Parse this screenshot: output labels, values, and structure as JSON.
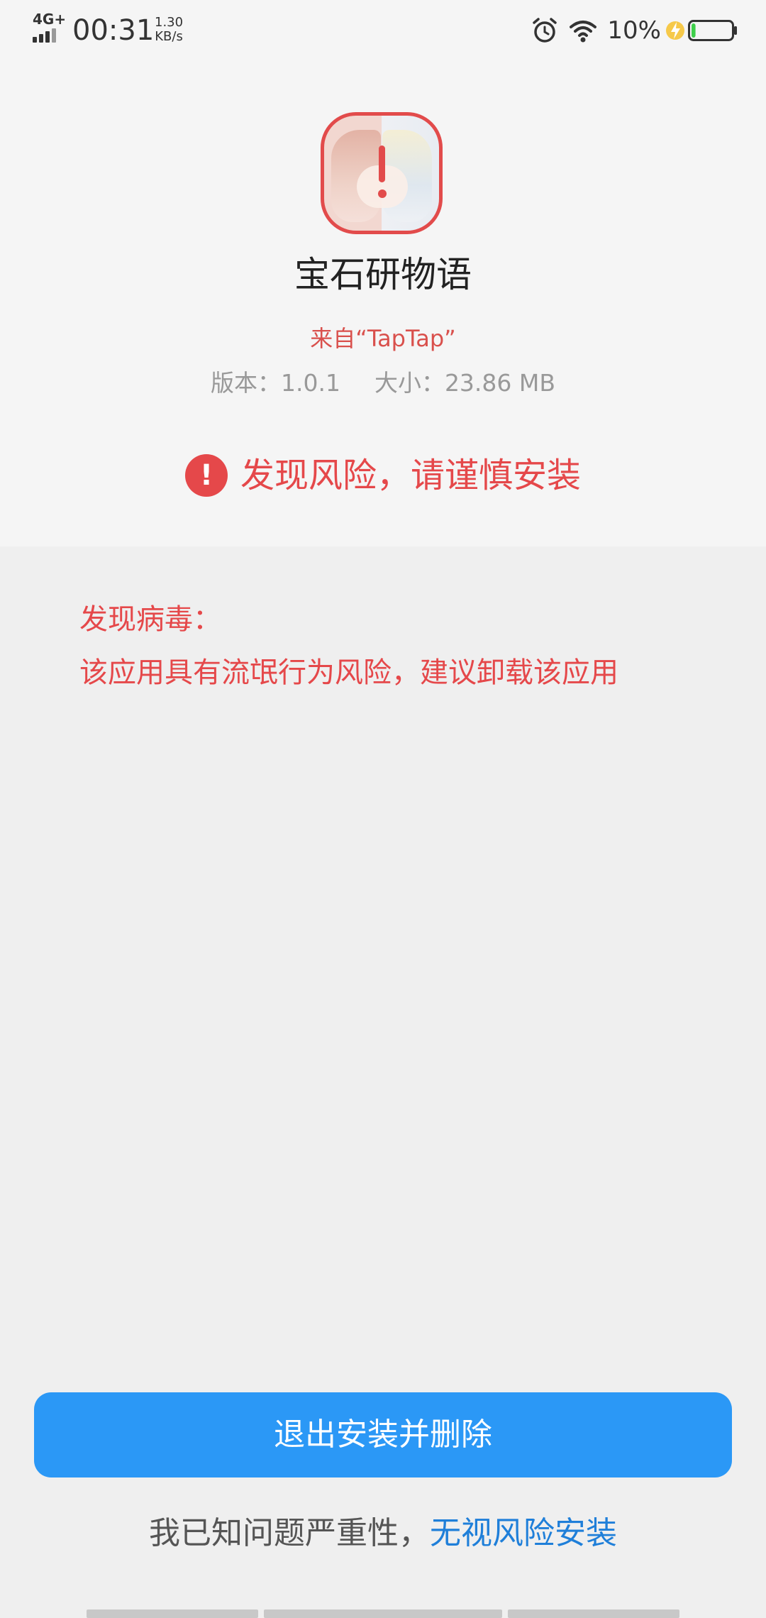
{
  "status_bar": {
    "network": "4G+",
    "time": "00:31",
    "speed_value": "1.30",
    "speed_unit": "KB/s",
    "battery_percent": "10%",
    "battery_level": 0.1,
    "icons": [
      "signal-icon",
      "alarm-icon",
      "wifi-icon",
      "charging-icon",
      "battery-icon"
    ]
  },
  "app": {
    "name": "宝石研物语",
    "source": "来自“TapTap”",
    "version": "版本：1.0.1",
    "size": "大小：23.86 MB",
    "icon": "app-icon-with-warning"
  },
  "risk": {
    "icon_glyph": "!",
    "message": "发现风险，请谨慎安装"
  },
  "details": {
    "title": "发现病毒：",
    "text": "该应用具有流氓行为风险，建议卸载该应用"
  },
  "actions": {
    "primary_label": "退出安装并删除",
    "secondary_prefix": "我已知问题严重性，",
    "secondary_link": "无视风险安装"
  },
  "colors": {
    "danger": "#e5484a",
    "primary": "#2b98f6",
    "link": "#1f7fd9"
  }
}
